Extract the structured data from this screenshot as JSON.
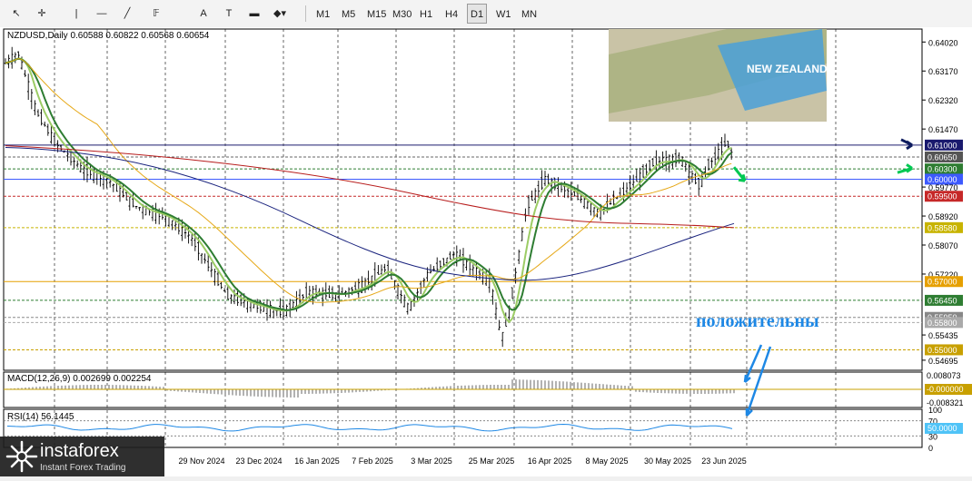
{
  "toolbar": {
    "tools": [
      {
        "name": "cursor-icon",
        "glyph": "↖"
      },
      {
        "name": "crosshair-icon",
        "glyph": "✛"
      },
      {
        "name": "vertical-line-icon",
        "glyph": "|"
      },
      {
        "name": "horizontal-line-icon",
        "glyph": "—"
      },
      {
        "name": "trendline-icon",
        "glyph": "╱"
      },
      {
        "name": "fibonacci-icon",
        "glyph": "𝔽"
      },
      {
        "name": "text-icon",
        "glyph": "A"
      },
      {
        "name": "label-icon",
        "glyph": "T"
      },
      {
        "name": "rectangle-icon",
        "glyph": "▬"
      },
      {
        "name": "shapes-icon",
        "glyph": "◆▾"
      }
    ],
    "timeframes": [
      "M1",
      "M5",
      "M15",
      "M30",
      "H1",
      "H4",
      "D1",
      "W1",
      "MN"
    ],
    "active_timeframe": "D1"
  },
  "chart": {
    "symbol_header": "NZDUSD,Daily  0.60588 0.60822 0.60568 0.60654",
    "price_ticks": [
      "0.64020",
      "0.63170",
      "0.62320",
      "0.61470",
      "0.59770",
      "0.58920",
      "0.58070",
      "0.57220",
      "0.55435",
      "0.54695"
    ],
    "price_boxes": [
      {
        "text": "0.61000",
        "bg": "#1a1a6e",
        "fg": "#ffffff"
      },
      {
        "text": "0.60650",
        "bg": "#555555",
        "fg": "#ffffff"
      },
      {
        "text": "0.60300",
        "bg": "#2e7d32",
        "fg": "#ffffff"
      },
      {
        "text": "0.60000",
        "bg": "#3d5afe",
        "fg": "#ffffff"
      },
      {
        "text": "0.59500",
        "bg": "#c62828",
        "fg": "#ffffff"
      },
      {
        "text": "0.58580",
        "bg": "#c8b400",
        "fg": "#ffffff"
      },
      {
        "text": "0.57000",
        "bg": "#e6a000",
        "fg": "#ffffff"
      },
      {
        "text": "0.56450",
        "bg": "#2e7d32",
        "fg": "#ffffff"
      },
      {
        "text": "0.55950",
        "bg": "#888888",
        "fg": "#ffffff"
      },
      {
        "text": "0.55800",
        "bg": "#aaaaaa",
        "fg": "#ffffff"
      },
      {
        "text": "0.55000",
        "bg": "#c8a000",
        "fg": "#ffffff"
      }
    ],
    "date_labels": [
      "29 Nov 2024",
      "23 Dec 2024",
      "16 Jan 2025",
      "7 Feb 2025",
      "3 Mar 2025",
      "25 Mar 2025",
      "16 Apr 2025",
      "8 May 2025",
      "30 May 2025",
      "23 Jun 2025"
    ],
    "annotation": "положительны",
    "macd": {
      "title": "MACD(12,26,9) 0.002699 0.002254",
      "ticks": [
        "0.008073",
        "-0.000000",
        "-0.008321"
      ],
      "zero_box": "-0.000000"
    },
    "rsi": {
      "title": "RSI(14) 56.1445",
      "ticks": [
        "100",
        "70",
        "30",
        "0"
      ],
      "box": "50.0000"
    }
  },
  "logo": {
    "brand": "instaforex",
    "sub": "Instant Forex Trading"
  },
  "colors": {
    "ema_fast": "#2e7d32",
    "ema_slow": "#9ccc65",
    "ma_50": "#e6a817",
    "ma_100": "#1a237e",
    "ma_200": "#b71c1c",
    "annotation": "#1e88e5",
    "arrow_navy": "#0d1b5e",
    "arrow_green": "#00c853"
  }
}
